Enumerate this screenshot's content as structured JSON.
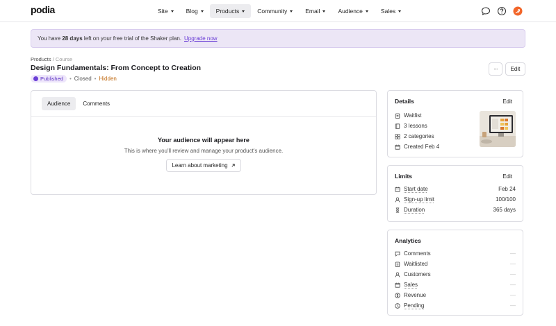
{
  "app": {
    "logo": "podia"
  },
  "nav": [
    {
      "label": "Site",
      "active": false
    },
    {
      "label": "Blog",
      "active": false
    },
    {
      "label": "Products",
      "active": true
    },
    {
      "label": "Community",
      "active": false
    },
    {
      "label": "Email",
      "active": false
    },
    {
      "label": "Audience",
      "active": false
    },
    {
      "label": "Sales",
      "active": false
    }
  ],
  "top_icons": [
    "chat-icon",
    "help-icon",
    "account-icon"
  ],
  "banner": {
    "prefix": "You have",
    "days": "28 days",
    "suffix": "left on your free trial of the Shaker plan.",
    "link": "Upgrade now"
  },
  "breadcrumb": {
    "root": "Products",
    "separator": "/",
    "current": "Course"
  },
  "product": {
    "title": "Design Fundamentals: From Concept to Creation",
    "status": "Published",
    "access": "Closed",
    "visibility": "Hidden"
  },
  "header_actions": {
    "more": "···",
    "edit": "Edit"
  },
  "tabs": [
    {
      "label": "Audience",
      "active": true
    },
    {
      "label": "Comments",
      "active": false
    }
  ],
  "empty_state": {
    "heading": "Your audience will appear here",
    "text": "This is where you'll review and manage your product's audience.",
    "button": "Learn about marketing",
    "button_icon": "arrow-up-right-icon"
  },
  "details": {
    "title": "Details",
    "edit": "Edit",
    "rows": [
      {
        "icon": "clipboard-icon",
        "label": "Waitlist"
      },
      {
        "icon": "book-icon",
        "label": "3 lessons"
      },
      {
        "icon": "grid-icon",
        "label": "2 categories"
      },
      {
        "icon": "calendar-icon",
        "label": "Created Feb 4"
      }
    ]
  },
  "limits": {
    "title": "Limits",
    "edit": "Edit",
    "rows": [
      {
        "icon": "calendar-icon",
        "label": "Start date",
        "value": "Feb 24"
      },
      {
        "icon": "user-icon",
        "label": "Sign-up limit",
        "value": "100/100"
      },
      {
        "icon": "hourglass-icon",
        "label": "Duration",
        "value": "365 days"
      }
    ]
  },
  "analytics": {
    "title": "Analytics",
    "rows": [
      {
        "icon": "comment-icon",
        "label": "Comments",
        "value": "—"
      },
      {
        "icon": "clipboard-icon",
        "label": "Waitlisted",
        "value": "—"
      },
      {
        "icon": "user-icon",
        "label": "Customers",
        "value": "—"
      },
      {
        "icon": "calendar-icon",
        "label": "Sales",
        "value": "—"
      },
      {
        "icon": "dollar-icon",
        "label": "Revenue",
        "value": "—"
      },
      {
        "icon": "clock-icon",
        "label": "Pending",
        "value": "—"
      }
    ]
  },
  "colors": {
    "accent": "#6b3fd6",
    "banner_bg": "#ece6f6",
    "hidden": "#c06a12",
    "logo_badge": "#f2662a"
  }
}
